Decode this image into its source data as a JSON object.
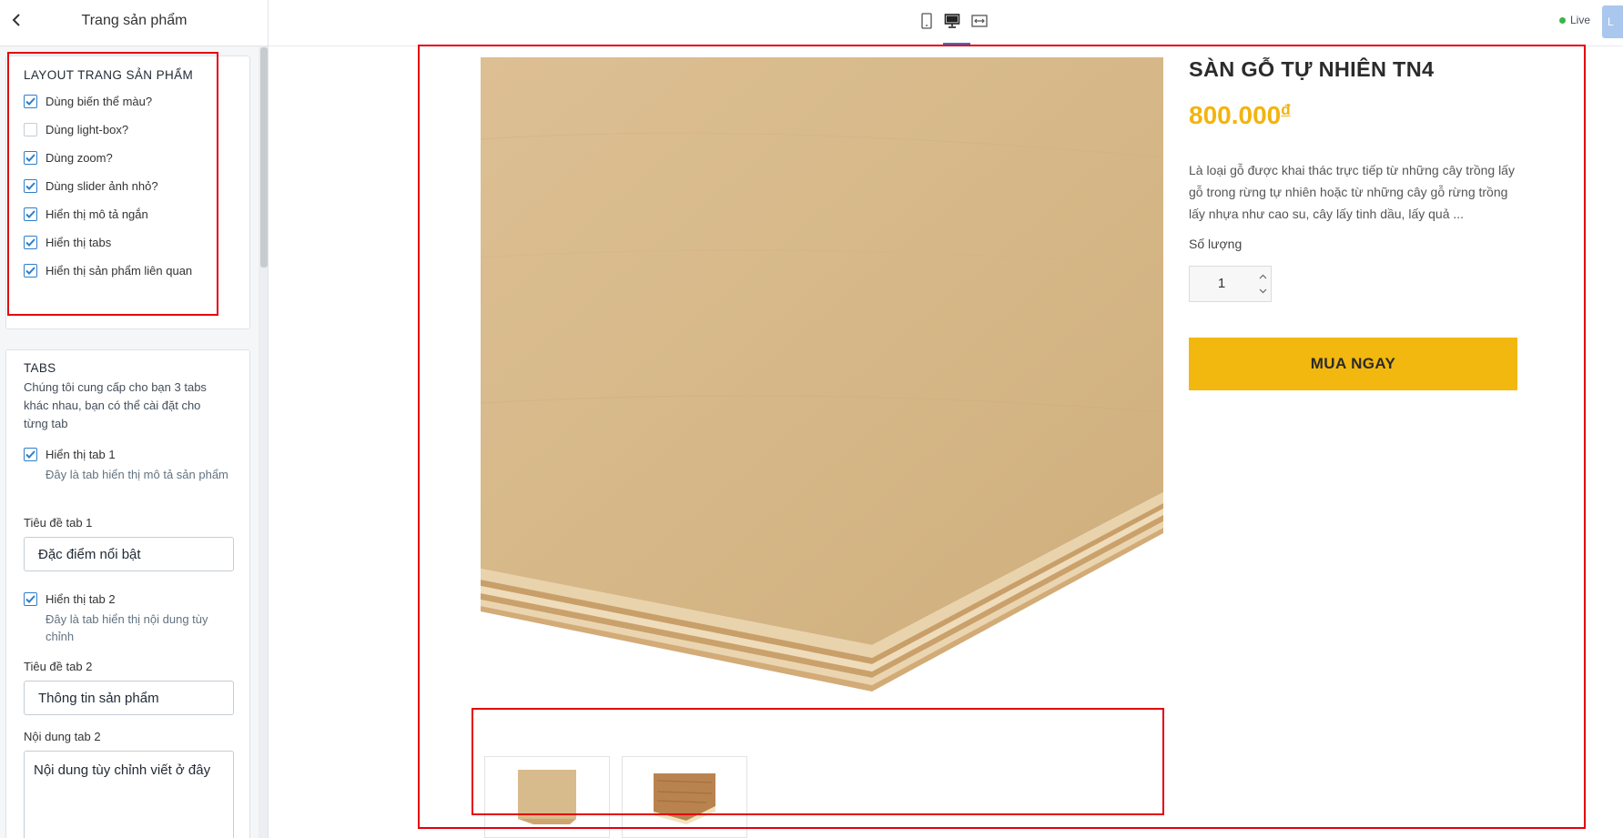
{
  "sidebar": {
    "title": "Trang sản phẩm",
    "layout_section": {
      "heading": "LAYOUT TRANG SẢN PHẨM",
      "options": [
        {
          "label": "Dùng biến thể màu?",
          "checked": true
        },
        {
          "label": "Dùng light-box?",
          "checked": false
        },
        {
          "label": "Dùng zoom?",
          "checked": true
        },
        {
          "label": "Dùng slider ảnh nhỏ?",
          "checked": true
        },
        {
          "label": "Hiển thị mô tả ngắn",
          "checked": true
        },
        {
          "label": "Hiển thị tabs",
          "checked": true
        },
        {
          "label": "Hiển thị sản phẩm liên quan",
          "checked": true
        }
      ]
    },
    "tabs_section": {
      "heading": "TABS",
      "description": "Chúng tôi cung cấp cho bạn 3 tabs khác nhau, bạn có thể cài đặt cho từng tab",
      "tab1_toggle": {
        "label": "Hiển thị tab 1",
        "checked": true,
        "help": "Đây là tab hiển thị mô tả sản phẩm"
      },
      "tab1_title_label": "Tiêu đề tab 1",
      "tab1_title_value": "Đặc điểm nổi bật",
      "tab2_toggle": {
        "label": "Hiển thị tab 2",
        "checked": true,
        "help": "Đây là tab hiển thị nội dung tùy chỉnh"
      },
      "tab2_title_label": "Tiêu đề tab 2",
      "tab2_title_value": "Thông tin sản phẩm",
      "tab2_content_label": "Nội dung tab 2",
      "tab2_content_value": "Nội dung tùy chỉnh viết ở đây"
    }
  },
  "topbar": {
    "devices": [
      "mobile-icon",
      "desktop-icon",
      "fullwidth-icon"
    ],
    "active_device": "desktop",
    "status": "Live",
    "status_color": "#3bb54a",
    "action_label": "L"
  },
  "product": {
    "title": "SÀN GỖ TỰ NHIÊN TN4",
    "price": "800.000",
    "currency": "đ",
    "description": "Là loại gỗ được khai thác trực tiếp từ những cây trồng lấy gỗ trong rừng tự nhiên hoặc từ những cây gỗ rừng trồng lấy nhựa như cao su, cây lấy tinh dầu, lấy quả ...",
    "quantity_label": "Số lượng",
    "quantity": "1",
    "buy_label": "MUA NGAY",
    "price_color": "#f2b40f",
    "button_color": "#f2b80f"
  },
  "annotation_color": "#e3000f"
}
